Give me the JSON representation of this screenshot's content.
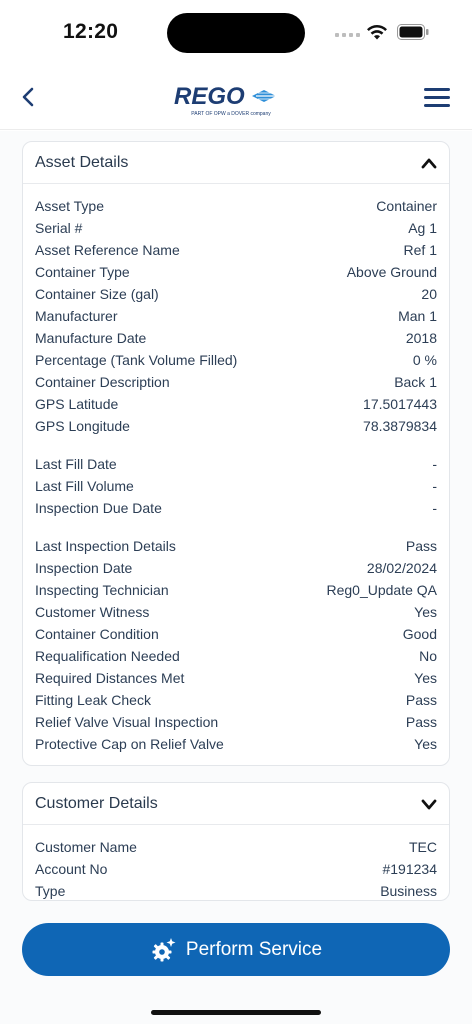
{
  "status": {
    "time": "12:20"
  },
  "header": {
    "brand": "REGO",
    "brand_tagline": "PART OF OPW   a DOVER company",
    "brand_color": "#1d3d73",
    "accent_color": "#2f8fd8"
  },
  "asset_details": {
    "title": "Asset Details",
    "rows": [
      {
        "label": "Asset Type",
        "value": "Container"
      },
      {
        "label": "Serial #",
        "value": "Ag 1"
      },
      {
        "label": "Asset Reference Name",
        "value": "Ref 1"
      },
      {
        "label": "Container Type",
        "value": "Above Ground"
      },
      {
        "label": "Container Size (gal)",
        "value": "20"
      },
      {
        "label": "Manufacturer",
        "value": "Man 1"
      },
      {
        "label": "Manufacture Date",
        "value": "2018"
      },
      {
        "label": "Percentage (Tank Volume Filled)",
        "value": "0 %"
      },
      {
        "label": "Container Description",
        "value": "Back 1"
      },
      {
        "label": "GPS Latitude",
        "value": "17.5017443"
      },
      {
        "label": "GPS Longitude",
        "value": "78.3879834"
      }
    ],
    "fill_rows": [
      {
        "label": "Last Fill Date",
        "value": "-"
      },
      {
        "label": "Last Fill Volume",
        "value": "-"
      },
      {
        "label": "Inspection Due Date",
        "value": "-"
      }
    ],
    "inspection_rows": [
      {
        "label": "Last Inspection Details",
        "value": "Pass"
      },
      {
        "label": "Inspection Date",
        "value": "28/02/2024"
      },
      {
        "label": "Inspecting Technician",
        "value": "Reg0_Update QA"
      },
      {
        "label": "Customer Witness",
        "value": "Yes"
      },
      {
        "label": "Container Condition",
        "value": "Good"
      },
      {
        "label": "Requalification Needed",
        "value": "No"
      },
      {
        "label": "Required Distances Met",
        "value": "Yes"
      },
      {
        "label": "Fitting Leak Check",
        "value": "Pass"
      },
      {
        "label": "Relief Valve Visual Inspection",
        "value": "Pass"
      },
      {
        "label": "Protective Cap on Relief Valve",
        "value": "Yes"
      }
    ]
  },
  "customer_details": {
    "title": "Customer Details",
    "rows": [
      {
        "label": "Customer Name",
        "value": "TEC"
      },
      {
        "label": "Account No",
        "value": "#191234"
      },
      {
        "label": "Type",
        "value": "Business"
      }
    ]
  },
  "actions": {
    "perform_service_label": "Perform Service",
    "button_color": "#0f66b5"
  }
}
